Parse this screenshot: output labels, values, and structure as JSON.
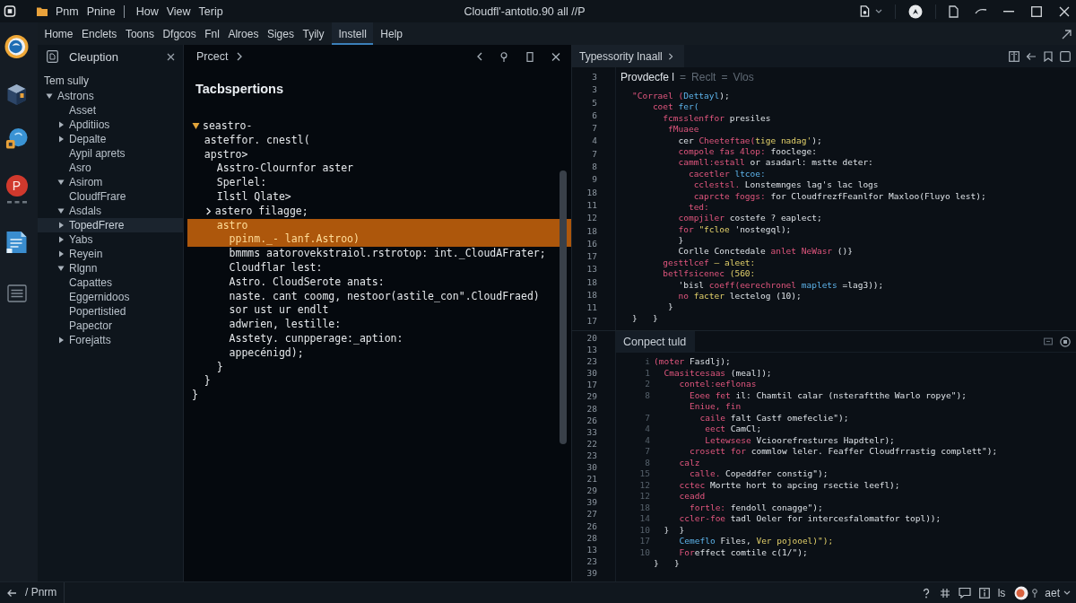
{
  "title_bar": {
    "menu": [
      "Pnm",
      "Pnine",
      "How",
      "View",
      "Terip"
    ],
    "title": "Cloudfl'-antotlo.90 all //P"
  },
  "menu_bar": {
    "items": [
      {
        "label": "Home",
        "selected": false
      },
      {
        "label": "Enclets",
        "selected": false
      },
      {
        "label": "Toons",
        "selected": false
      },
      {
        "label": "Dfgcos",
        "selected": false
      },
      {
        "label": "Fnl",
        "selected": false
      },
      {
        "label": "Alroes",
        "selected": false
      },
      {
        "label": "Siges",
        "selected": false
      },
      {
        "label": "Tyily",
        "selected": false
      },
      {
        "label": "Instell",
        "selected": true
      },
      {
        "label": "Help",
        "selected": false
      }
    ]
  },
  "activity_bar": {
    "profile_letter": "P"
  },
  "sidebar": {
    "title": "Cleuption",
    "section": "Tem sully",
    "tree": [
      {
        "label": "Astrons",
        "expanded": true,
        "selected": false,
        "children": [
          {
            "label": "Asset",
            "selected": false
          },
          {
            "label": "Apditiios",
            "expanded": false,
            "selected": false
          },
          {
            "label": "Depalte",
            "expanded": false,
            "selected": false
          },
          {
            "label": "Aypil aprets",
            "selected": false
          },
          {
            "label": "Asro",
            "selected": false
          },
          {
            "label": "Asirom",
            "expanded": true,
            "selected": false
          },
          {
            "label": "CloudfFrare",
            "selected": false
          },
          {
            "label": "Asdals",
            "expanded": true,
            "selected": false
          },
          {
            "label": "TopedFrere",
            "expanded": false,
            "selected": true
          },
          {
            "label": "Yabs",
            "expanded": false,
            "selected": false
          },
          {
            "label": "Reyein",
            "expanded": false,
            "selected": false
          },
          {
            "label": "Rlgnn",
            "expanded": true,
            "selected": false
          },
          {
            "label": "Capattes",
            "selected": false
          },
          {
            "label": "Eggernidoos",
            "selected": false
          },
          {
            "label": "Popertistied",
            "selected": false
          },
          {
            "label": "Papector",
            "selected": false
          },
          {
            "label": "Forejatts",
            "expanded": false,
            "selected": false
          }
        ]
      }
    ]
  },
  "editor": {
    "tab": "Prcect",
    "heading": "Tacbspertions",
    "lines": [
      {
        "text": "seastro-",
        "kind": "fold-open",
        "highlighted": false
      },
      {
        "text": "  asteffor. cnestl(",
        "kind": "code",
        "highlighted": false
      },
      {
        "text": "  apstro>",
        "kind": "code",
        "highlighted": false
      },
      {
        "text": "    Asstro-Clournfor aster",
        "kind": "code",
        "highlighted": false
      },
      {
        "text": "    Sperlel:",
        "kind": "code",
        "highlighted": false
      },
      {
        "text": "    Ilstl Qlate>",
        "kind": "code",
        "highlighted": false
      },
      {
        "text": "  astero filagge;",
        "kind": "fold-closed",
        "highlighted": false
      },
      {
        "text": "    astro",
        "kind": "code",
        "highlighted": true
      },
      {
        "text": "      ppinm._- lanf.Astroo)",
        "kind": "code",
        "highlighted": true
      },
      {
        "text": "      bmmms aatorovekstraiol.rstrotop: int._CloudAFrater;",
        "kind": "code",
        "highlighted": false
      },
      {
        "text": "      Cloudflar lest:",
        "kind": "code",
        "highlighted": false
      },
      {
        "text": "      Astro. CloudSerote anats:",
        "kind": "code",
        "highlighted": false
      },
      {
        "text": "      naste. cant coomg, nestoor(astile_con\".CloudFraed)",
        "kind": "code",
        "highlighted": false
      },
      {
        "text": "      sor ust ur endlt",
        "kind": "code",
        "highlighted": false
      },
      {
        "text": "      adwrien, lestille:",
        "kind": "code",
        "highlighted": false
      },
      {
        "text": "      Asstety. cunpperage:_aption:",
        "kind": "code",
        "highlighted": false
      },
      {
        "text": "      appecénigd);",
        "kind": "code",
        "highlighted": false
      },
      {
        "text": "    }",
        "kind": "code",
        "highlighted": false
      },
      {
        "text": "  }",
        "kind": "code",
        "highlighted": false
      },
      {
        "text": "}",
        "kind": "code",
        "highlighted": false
      }
    ]
  },
  "right_pane": {
    "tab": "Typessority Inaall",
    "top": {
      "breadcrumb": [
        {
          "label": "Provdecfe l",
          "kind": "current"
        },
        {
          "label": "=",
          "kind": "separator"
        },
        {
          "label": "Reclt",
          "kind": "crumb"
        },
        {
          "label": "=",
          "kind": "separator"
        },
        {
          "label": "Vlos",
          "kind": "crumb"
        }
      ],
      "line_numbers": [
        "3",
        "3",
        "5",
        "6",
        "7",
        "4",
        "7",
        "8",
        "9",
        "18",
        "11",
        "12",
        "18",
        "16",
        "17",
        "13",
        "18",
        "18",
        "11",
        "17"
      ],
      "lines": [
        {
          "segments": [
            {
              "text": "\"Corrael (",
              "kind": "keyword"
            },
            {
              "text": "Dettayl",
              "kind": "type"
            },
            {
              "text": ");",
              "kind": "plain"
            }
          ]
        },
        {
          "segments": [
            {
              "text": "    coet",
              "kind": "keyword"
            },
            {
              "text": " fer(",
              "kind": "type"
            }
          ]
        },
        {
          "segments": [
            {
              "text": "      fcmsslenffor",
              "kind": "keyword"
            },
            {
              "text": " presiles",
              "kind": "plain"
            }
          ]
        },
        {
          "segments": [
            {
              "text": "       fMuaee",
              "kind": "keyword"
            }
          ]
        },
        {
          "segments": [
            {
              "text": "         cer ",
              "kind": "plain"
            },
            {
              "text": "Cheeteftae(",
              "kind": "keyword"
            },
            {
              "text": "tige nadag'",
              "kind": "string"
            },
            {
              "text": ");",
              "kind": "plain"
            }
          ]
        },
        {
          "segments": [
            {
              "text": "         compole fas 4lop:",
              "kind": "keyword"
            },
            {
              "text": " fooclege:",
              "kind": "plain"
            }
          ]
        },
        {
          "segments": [
            {
              "text": "         cammll:estall",
              "kind": "keyword"
            },
            {
              "text": " or asadarl: mstte deter:",
              "kind": "plain"
            }
          ]
        },
        {
          "segments": [
            {
              "text": "           cacetler",
              "kind": "keyword"
            },
            {
              "text": " ltcoe:",
              "kind": "type"
            }
          ]
        },
        {
          "segments": [
            {
              "text": "            cclestsl.",
              "kind": "keyword"
            },
            {
              "text": " Lonstemnges lag's lac logs",
              "kind": "plain"
            }
          ]
        },
        {
          "segments": [
            {
              "text": "            caprcte foggs:",
              "kind": "keyword"
            },
            {
              "text": " for CloudfrezfFeanlfor Maxloo(Fluyo lest);",
              "kind": "plain"
            }
          ]
        },
        {
          "segments": [
            {
              "text": "           ted:",
              "kind": "keyword"
            }
          ]
        },
        {
          "segments": [
            {
              "text": "         compjiler",
              "kind": "keyword"
            },
            {
              "text": " costefe ? eaplect;",
              "kind": "plain"
            }
          ]
        },
        {
          "segments": [
            {
              "text": "         for",
              "kind": "keyword"
            },
            {
              "text": " \"fcloe",
              "kind": "string"
            },
            {
              "text": " 'nostegql);",
              "kind": "plain"
            }
          ]
        },
        {
          "segments": [
            {
              "text": "         }",
              "kind": "plain"
            }
          ]
        },
        {
          "segments": [
            {
              "text": "         Corlle Conctedale ",
              "kind": "plain"
            },
            {
              "text": "anlet NeWasr",
              "kind": "keyword"
            },
            {
              "text": " ()}",
              "kind": "plain"
            }
          ]
        },
        {
          "segments": [
            {
              "text": "      gesttlcef",
              "kind": "keyword"
            },
            {
              "text": " — aleet:",
              "kind": "string"
            }
          ]
        },
        {
          "segments": [
            {
              "text": "      betlfsicenec",
              "kind": "keyword"
            },
            {
              "text": " (560:",
              "kind": "string"
            }
          ]
        },
        {
          "segments": [
            {
              "text": "         'bisl ",
              "kind": "plain"
            },
            {
              "text": "coeff(eerechronel",
              "kind": "keyword"
            },
            {
              "text": " maplets",
              "kind": "type"
            },
            {
              "text": " =lag3));",
              "kind": "plain"
            }
          ]
        },
        {
          "segments": [
            {
              "text": "         no",
              "kind": "keyword"
            },
            {
              "text": " facter",
              "kind": "string"
            },
            {
              "text": " lectelog (10);",
              "kind": "plain"
            }
          ]
        },
        {
          "segments": [
            {
              "text": "       }",
              "kind": "plain"
            }
          ]
        },
        {
          "segments": [
            {
              "text": "}   }",
              "kind": "plain"
            }
          ]
        }
      ]
    },
    "bottom": {
      "tab": "Conpect tuld",
      "line_numbers": [
        "20",
        "13",
        "23",
        "30",
        "17",
        "29",
        "28",
        "26",
        "33",
        "22",
        "23",
        "30",
        "21",
        "29",
        "39",
        "27",
        "26",
        "28",
        "13",
        "23",
        "39"
      ],
      "lines": [
        {
          "number": "i",
          "segments": [
            {
              "text": "(moter",
              "kind": "keyword"
            },
            {
              "text": " Fasdlj);",
              "kind": "plain"
            }
          ]
        },
        {
          "number": "1",
          "segments": [
            {
              "text": "  Cmasitcesaas",
              "kind": "keyword"
            },
            {
              "text": " (meal]);",
              "kind": "plain"
            }
          ]
        },
        {
          "number": "2",
          "segments": [
            {
              "text": "     contel:eeflonas",
              "kind": "keyword"
            }
          ]
        },
        {
          "number": "8",
          "segments": [
            {
              "text": "       Eoee fet",
              "kind": "keyword"
            },
            {
              "text": " il: Chamtil calar (nsteraftthe Warlo ropye\");",
              "kind": "plain"
            }
          ]
        },
        {
          "segments": [
            {
              "text": "       Eniue, fin",
              "kind": "keyword"
            }
          ]
        },
        {
          "number": "7",
          "segments": [
            {
              "text": "         caile",
              "kind": "keyword"
            },
            {
              "text": " falt Castf omefeclie\");",
              "kind": "plain"
            }
          ]
        },
        {
          "number": "4",
          "segments": [
            {
              "text": "          eect",
              "kind": "keyword"
            },
            {
              "text": " CamCl;",
              "kind": "plain"
            }
          ]
        },
        {
          "number": "4",
          "segments": [
            {
              "text": "          Letewsese",
              "kind": "keyword"
            },
            {
              "text": " Vcioorefrestures Hapdtelr);",
              "kind": "plain"
            }
          ]
        },
        {
          "number": "7",
          "segments": [
            {
              "text": "       crosett for",
              "kind": "keyword"
            },
            {
              "text": " commlow leler. Feaffer Cloudfrrastig complett\");",
              "kind": "plain"
            }
          ]
        },
        {
          "number": "8",
          "segments": [
            {
              "text": "     calz",
              "kind": "keyword"
            }
          ]
        },
        {
          "number": "15",
          "segments": [
            {
              "text": "       calle.",
              "kind": "keyword"
            },
            {
              "text": " Copeddfer constig\");",
              "kind": "plain"
            }
          ]
        },
        {
          "number": "12",
          "segments": [
            {
              "text": "     cctec",
              "kind": "keyword"
            },
            {
              "text": " Mortte hort to apcing rsectie leefl);",
              "kind": "plain"
            }
          ]
        },
        {
          "number": "12",
          "segments": [
            {
              "text": "     ceadd",
              "kind": "keyword"
            }
          ]
        },
        {
          "number": "18",
          "segments": [
            {
              "text": "       fortle:",
              "kind": "keyword"
            },
            {
              "text": " fendoll conagge\");",
              "kind": "plain"
            }
          ]
        },
        {
          "number": "14",
          "segments": [
            {
              "text": "     ccler-foe",
              "kind": "keyword"
            },
            {
              "text": " tadl Oeler for intercesfalomatfor topl));",
              "kind": "plain"
            }
          ]
        },
        {
          "number": "10",
          "segments": [
            {
              "text": "  }  }",
              "kind": "plain"
            }
          ]
        },
        {
          "number": "17",
          "segments": [
            {
              "text": "     Cemeflo",
              "kind": "type"
            },
            {
              "text": " Files,",
              "kind": "plain"
            },
            {
              "text": " Ver pojooel)\");",
              "kind": "string"
            }
          ]
        },
        {
          "number": "10",
          "segments": [
            {
              "text": "     For",
              "kind": "keyword"
            },
            {
              "text": "effect comtile c(1/\");",
              "kind": "plain"
            }
          ]
        },
        {
          "segments": [
            {
              "text": "}   }",
              "kind": "plain"
            }
          ]
        }
      ]
    }
  },
  "status_bar": {
    "path": "/ Pnrm",
    "items": [
      "ls",
      "aet"
    ]
  }
}
